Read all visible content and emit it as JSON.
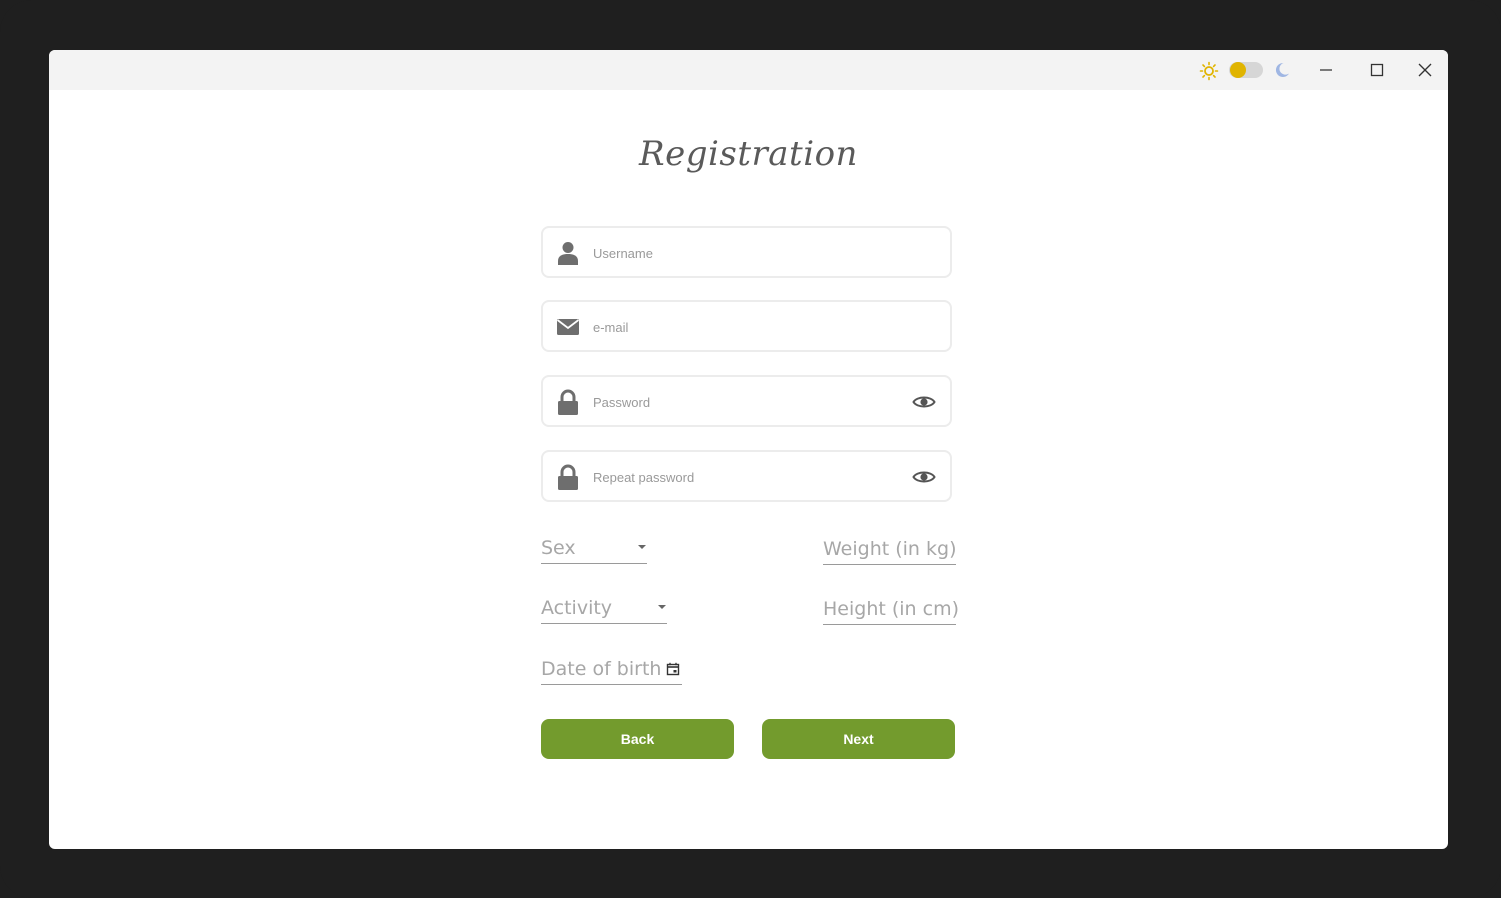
{
  "window": {
    "theme_toggle": {
      "state": "light",
      "knob_color": "#e0b400",
      "track_color": "#d6d6d6"
    },
    "controls": [
      "minimize-icon",
      "maximize-icon",
      "close-icon"
    ]
  },
  "title": "Registration",
  "fields": {
    "username": {
      "placeholder": "Username",
      "value": "",
      "icon": "user-icon"
    },
    "email": {
      "placeholder": "e-mail",
      "value": "",
      "icon": "envelope-icon"
    },
    "password": {
      "placeholder": "Password",
      "value": "",
      "icon": "lock-icon",
      "toggle_icon": "eye-icon"
    },
    "repeat_password": {
      "placeholder": "Repeat password",
      "value": "",
      "icon": "lock-icon",
      "toggle_icon": "eye-icon"
    }
  },
  "selects": {
    "sex": {
      "label": "Sex",
      "value": ""
    },
    "activity": {
      "label": "Activity",
      "value": ""
    }
  },
  "inputs": {
    "weight": {
      "label": "Weight (in kg)",
      "value": ""
    },
    "height": {
      "label": "Height (in cm)",
      "value": ""
    },
    "date_of_birth": {
      "label": "Date of birth",
      "value": ""
    }
  },
  "buttons": {
    "back": "Back",
    "next": "Next"
  },
  "colors": {
    "accent": "#739b2d",
    "icon": "#6e6e6e",
    "placeholder": "#9a9a9a"
  }
}
